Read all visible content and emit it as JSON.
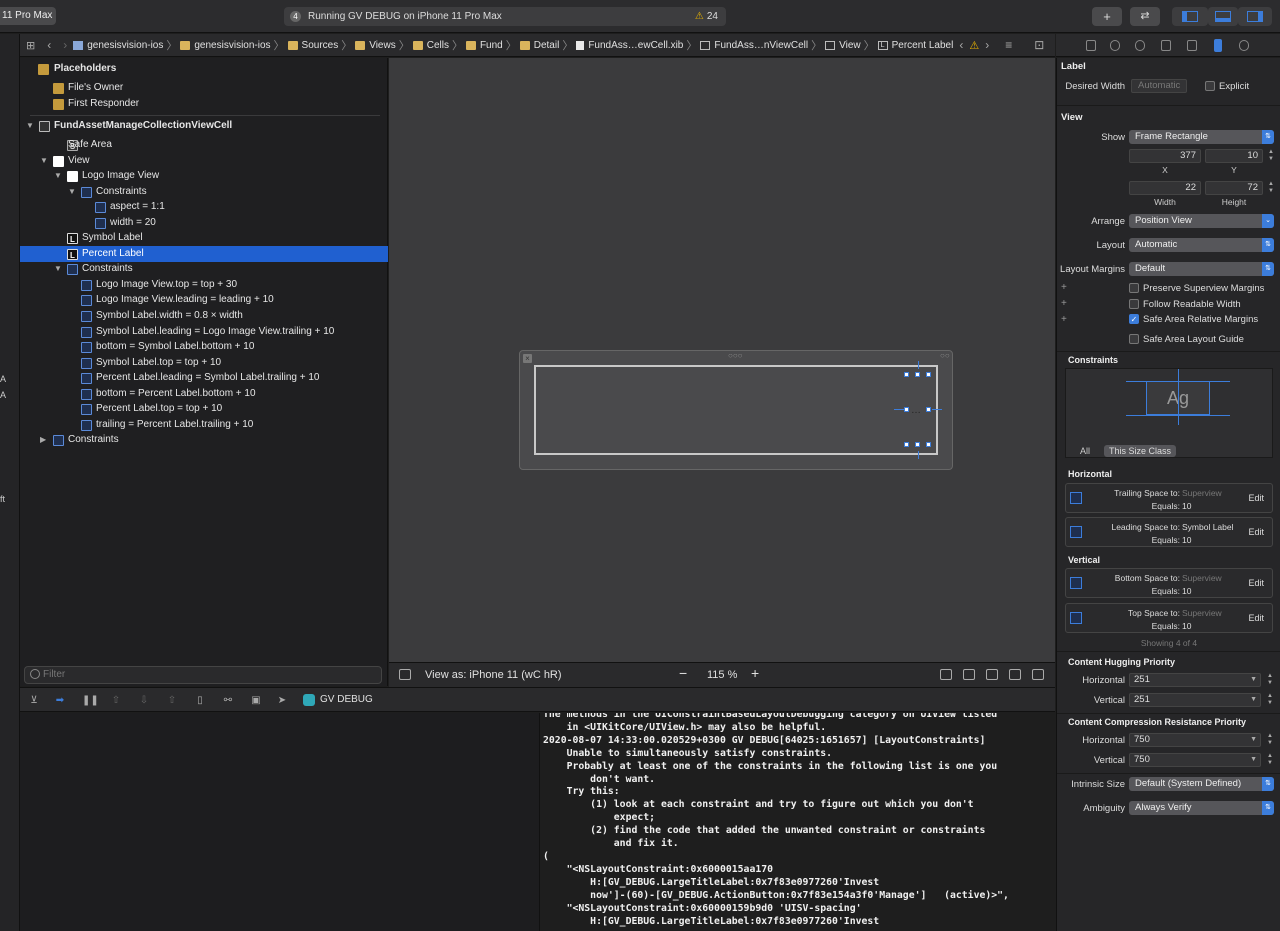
{
  "toolbar": {
    "scheme": "11 Pro Max",
    "activity_num": "4",
    "activity_text": "Running GV DEBUG on iPhone 11 Pro Max",
    "warning_count": "24"
  },
  "gutter": {
    "a1": "A",
    "a2": "A",
    "ft": "ft"
  },
  "jumpbar": {
    "crumbs": [
      "genesisvision-ios",
      "genesisvision-ios",
      "Sources",
      "Views",
      "Cells",
      "Fund",
      "Detail",
      "FundAss…ewCell.xib",
      "FundAss…nViewCell",
      "View",
      "Percent Label"
    ]
  },
  "outline": {
    "rows": [
      "Placeholders",
      "File's Owner",
      "First Responder",
      "FundAssetManageCollectionViewCell",
      "Safe Area",
      "View",
      "Logo Image View",
      "Constraints",
      "aspect = 1:1",
      "width = 20",
      "Symbol Label",
      "Percent Label",
      "Constraints",
      "Logo Image View.top = top + 30",
      "Logo Image View.leading = leading + 10",
      "Symbol Label.width = 0.8 × width",
      "Symbol Label.leading = Logo Image View.trailing + 10",
      "bottom = Symbol Label.bottom + 10",
      "Symbol Label.top = top + 10",
      "Percent Label.leading = Symbol Label.trailing + 10",
      "bottom = Percent Label.bottom + 10",
      "Percent Label.top = top + 10",
      "trailing = Percent Label.trailing + 10",
      "Constraints"
    ],
    "filter_placeholder": "Filter"
  },
  "canvasbar": {
    "view_as": "View as: iPhone 11 (wC hR)",
    "zoom": "115 %"
  },
  "debugbar": {
    "target": "GV DEBUG"
  },
  "console": {
    "text": "The methods in the UIConstraintBasedLayoutDebugging category on UIView listed\n    in <UIKitCore/UIView.h> may also be helpful.\n2020-08-07 14:33:00.020529+0300 GV DEBUG[64025:1651657] [LayoutConstraints]\n    Unable to simultaneously satisfy constraints.\n    Probably at least one of the constraints in the following list is one you\n        don't want.\n    Try this:\n        (1) look at each constraint and try to figure out which you don't\n            expect;\n        (2) find the code that added the unwanted constraint or constraints\n            and fix it.\n(\n    \"<NSLayoutConstraint:0x6000015aa170\n        H:[GV_DEBUG.LargeTitleLabel:0x7f83e0977260'Invest\n        now']-(60)-[GV_DEBUG.ActionButton:0x7f83e154a3f0'Manage']   (active)>\",\n    \"<NSLayoutConstraint:0x60000159b9d0 'UISV-spacing'\n        H:[GV_DEBUG.LargeTitleLabel:0x7f83e0977260'Invest"
  },
  "inspector": {
    "label_header": "Label",
    "desired_width_label": "Desired Width",
    "desired_width_value": "Automatic",
    "explicit_label": "Explicit",
    "view_header": "View",
    "show_label": "Show",
    "show_value": "Frame Rectangle",
    "x": "377",
    "y": "10",
    "width": "22",
    "height": "72",
    "x_cap": "X",
    "y_cap": "Y",
    "w_cap": "Width",
    "h_cap": "Height",
    "arrange_label": "Arrange",
    "arrange_value": "Position View",
    "layout_label": "Layout",
    "layout_value": "Automatic",
    "margins_label": "Layout Margins",
    "margins_value": "Default",
    "preserve": "Preserve Superview Margins",
    "readable": "Follow Readable Width",
    "safe_relative": "Safe Area Relative Margins",
    "safe_guide": "Safe Area Layout Guide",
    "constraints_header": "Constraints",
    "ag": "Ag",
    "seg_all": "All",
    "seg_this": "This Size Class",
    "horizontal_header": "Horizontal",
    "vertical_header": "Vertical",
    "cards": [
      {
        "l1": "Trailing Space to:",
        "v1": "Superview",
        "l2": "Equals:",
        "v2": "10",
        "lit": false
      },
      {
        "l1": "Leading Space to:",
        "v1": "Symbol Label",
        "l2": "Equals:",
        "v2": "10",
        "lit": true
      },
      {
        "l1": "Bottom Space to:",
        "v1": "Superview",
        "l2": "Equals:",
        "v2": "10",
        "lit": false
      },
      {
        "l1": "Top Space to:",
        "v1": "Superview",
        "l2": "Equals:",
        "v2": "10",
        "lit": false
      }
    ],
    "edit": "Edit",
    "showing": "Showing 4 of 4",
    "hugging_header": "Content Hugging Priority",
    "hug_h_label": "Horizontal",
    "hug_h": "251",
    "hug_v_label": "Vertical",
    "hug_v": "251",
    "compression_header": "Content Compression Resistance Priority",
    "comp_h_label": "Horizontal",
    "comp_h": "750",
    "comp_v_label": "Vertical",
    "comp_v": "750",
    "intrinsic_label": "Intrinsic Size",
    "intrinsic_value": "Default (System Defined)",
    "ambiguity_label": "Ambiguity",
    "ambiguity_value": "Always Verify"
  },
  "colors": {
    "accent": "#3c7ddb",
    "selection": "#2060d0",
    "warning": "#e8b300"
  }
}
